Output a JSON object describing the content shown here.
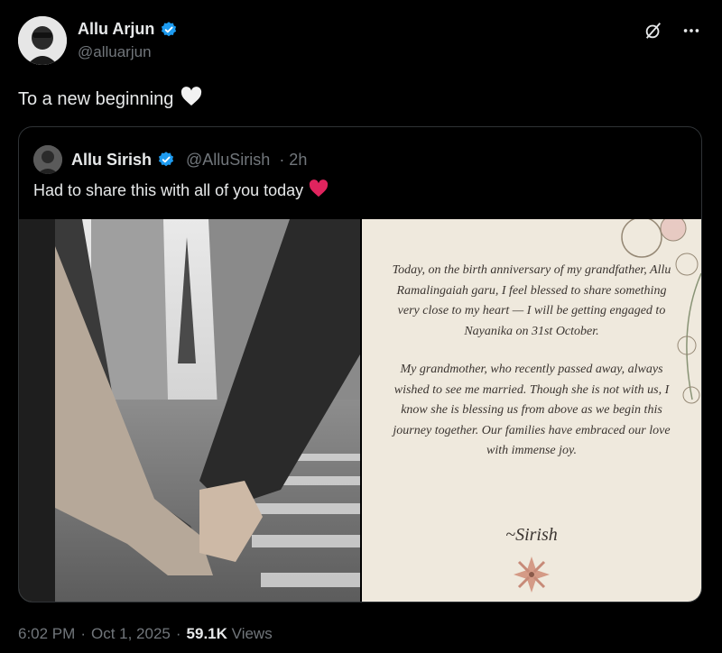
{
  "author": {
    "name": "Allu Arjun",
    "handle": "@alluarjun"
  },
  "tweet": {
    "text": "To a new beginning"
  },
  "quoted": {
    "name": "Allu Sirish",
    "handle": "@AlluSirish",
    "time": "· 2h",
    "text": "Had to share this with all of you today"
  },
  "letter": {
    "paragraph1": "Today, on the birth anniversary of my grandfather, Allu Ramalingaiah garu, I feel blessed to share something very close to my heart — I will be getting engaged to Nayanika on 31st October.",
    "paragraph2": "My grandmother, who recently passed away, always wished to see me married. Though she is not with us, I know she is blessing us from above as we begin this journey together. Our families have embraced our love with immense joy.",
    "signature": "~Sirish"
  },
  "meta": {
    "time": "6:02 PM",
    "date": "Oct 1, 2025",
    "views_count": "59.1K",
    "views_label": "Views"
  },
  "colors": {
    "background": "#000000",
    "text": "#e7e9ea",
    "muted": "#71767b",
    "verified": "#1d9bf0",
    "heart_red": "#f91880",
    "paper": "#efe9dd"
  },
  "icons": {
    "grok": "grok-icon",
    "more": "more-icon",
    "verified": "verified-badge-icon",
    "white_heart": "white-heart-icon",
    "red_heart": "red-heart-icon"
  }
}
